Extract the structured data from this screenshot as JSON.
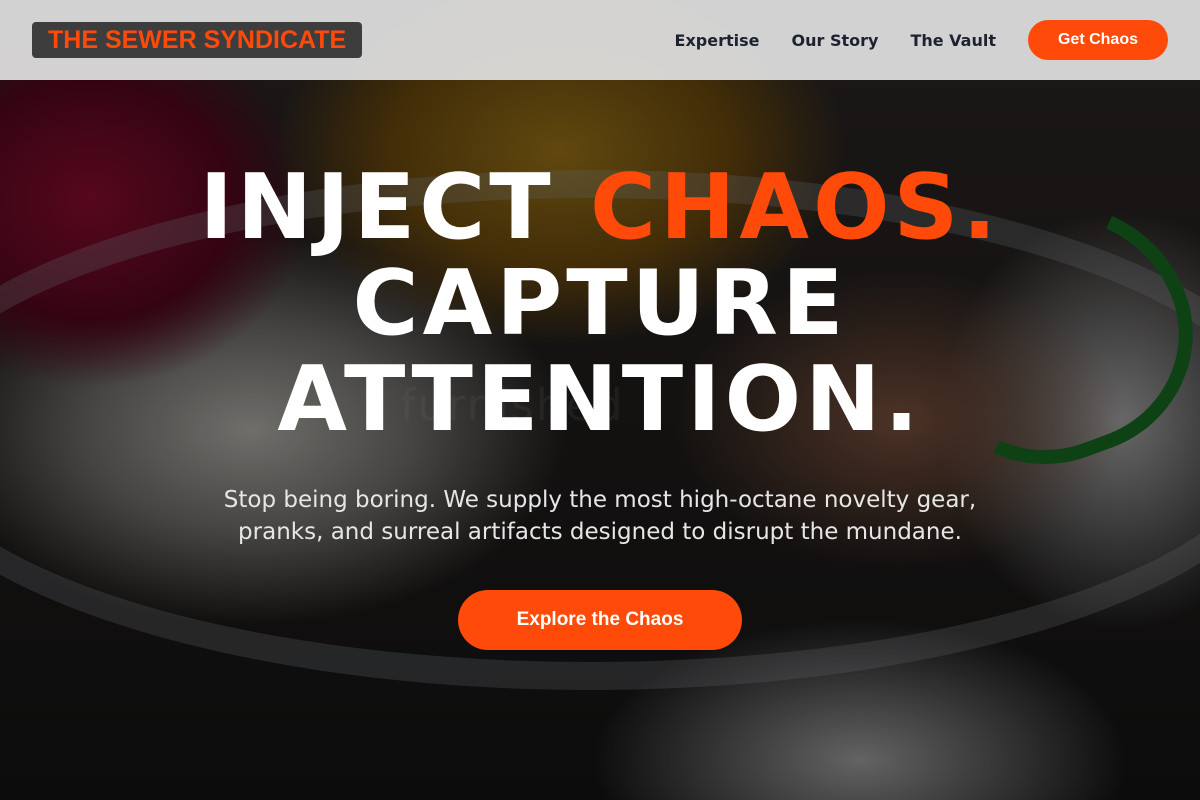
{
  "brand": {
    "logo_text": "THE SEWER SYNDICATE",
    "accent_color": "#ff4a0a"
  },
  "nav": {
    "links": [
      "Expertise",
      "Our Story",
      "The Vault"
    ],
    "cta_label": "Get Chaos"
  },
  "hero": {
    "headline_part1": "INJECT ",
    "headline_accent": "CHAOS.",
    "headline_line2": "CAPTURE",
    "headline_line3": "ATTENTION.",
    "subtitle": "Stop being boring. We supply the most high-octane novelty gear, pranks, and surreal artifacts designed to disrupt the mundane.",
    "cta_label": "Explore the Chaos",
    "watermark": "furnished"
  }
}
